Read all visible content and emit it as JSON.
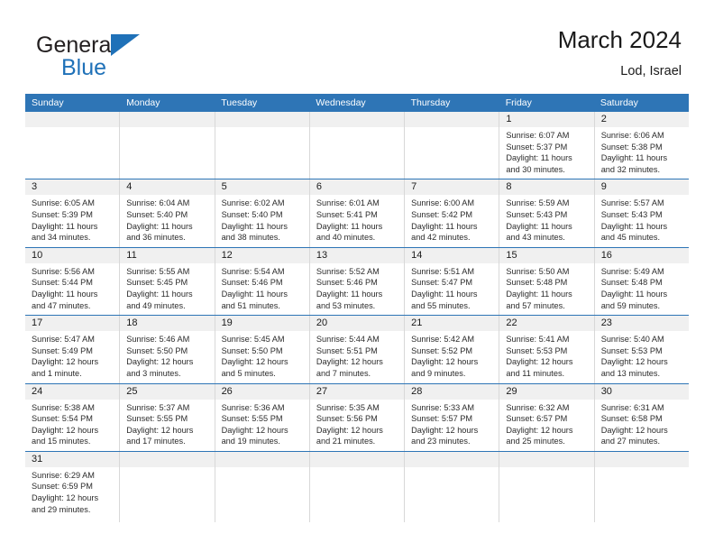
{
  "brand": {
    "name_part1": "General",
    "name_part2": "Blue",
    "logo_icon": "blue-triangle-flag-icon"
  },
  "header": {
    "title": "March 2024",
    "location": "Lod, Israel"
  },
  "colors": {
    "header_blue": "#2e75b6",
    "brand_blue": "#1f71b8",
    "day_band_grey": "#f0f0f0",
    "cell_border": "#d8d8d8"
  },
  "weekdays": [
    "Sunday",
    "Monday",
    "Tuesday",
    "Wednesday",
    "Thursday",
    "Friday",
    "Saturday"
  ],
  "weeks": [
    [
      {
        "day": "",
        "lines": []
      },
      {
        "day": "",
        "lines": []
      },
      {
        "day": "",
        "lines": []
      },
      {
        "day": "",
        "lines": []
      },
      {
        "day": "",
        "lines": []
      },
      {
        "day": "1",
        "lines": [
          "Sunrise: 6:07 AM",
          "Sunset: 5:37 PM",
          "Daylight: 11 hours",
          "and 30 minutes."
        ]
      },
      {
        "day": "2",
        "lines": [
          "Sunrise: 6:06 AM",
          "Sunset: 5:38 PM",
          "Daylight: 11 hours",
          "and 32 minutes."
        ]
      }
    ],
    [
      {
        "day": "3",
        "lines": [
          "Sunrise: 6:05 AM",
          "Sunset: 5:39 PM",
          "Daylight: 11 hours",
          "and 34 minutes."
        ]
      },
      {
        "day": "4",
        "lines": [
          "Sunrise: 6:04 AM",
          "Sunset: 5:40 PM",
          "Daylight: 11 hours",
          "and 36 minutes."
        ]
      },
      {
        "day": "5",
        "lines": [
          "Sunrise: 6:02 AM",
          "Sunset: 5:40 PM",
          "Daylight: 11 hours",
          "and 38 minutes."
        ]
      },
      {
        "day": "6",
        "lines": [
          "Sunrise: 6:01 AM",
          "Sunset: 5:41 PM",
          "Daylight: 11 hours",
          "and 40 minutes."
        ]
      },
      {
        "day": "7",
        "lines": [
          "Sunrise: 6:00 AM",
          "Sunset: 5:42 PM",
          "Daylight: 11 hours",
          "and 42 minutes."
        ]
      },
      {
        "day": "8",
        "lines": [
          "Sunrise: 5:59 AM",
          "Sunset: 5:43 PM",
          "Daylight: 11 hours",
          "and 43 minutes."
        ]
      },
      {
        "day": "9",
        "lines": [
          "Sunrise: 5:57 AM",
          "Sunset: 5:43 PM",
          "Daylight: 11 hours",
          "and 45 minutes."
        ]
      }
    ],
    [
      {
        "day": "10",
        "lines": [
          "Sunrise: 5:56 AM",
          "Sunset: 5:44 PM",
          "Daylight: 11 hours",
          "and 47 minutes."
        ]
      },
      {
        "day": "11",
        "lines": [
          "Sunrise: 5:55 AM",
          "Sunset: 5:45 PM",
          "Daylight: 11 hours",
          "and 49 minutes."
        ]
      },
      {
        "day": "12",
        "lines": [
          "Sunrise: 5:54 AM",
          "Sunset: 5:46 PM",
          "Daylight: 11 hours",
          "and 51 minutes."
        ]
      },
      {
        "day": "13",
        "lines": [
          "Sunrise: 5:52 AM",
          "Sunset: 5:46 PM",
          "Daylight: 11 hours",
          "and 53 minutes."
        ]
      },
      {
        "day": "14",
        "lines": [
          "Sunrise: 5:51 AM",
          "Sunset: 5:47 PM",
          "Daylight: 11 hours",
          "and 55 minutes."
        ]
      },
      {
        "day": "15",
        "lines": [
          "Sunrise: 5:50 AM",
          "Sunset: 5:48 PM",
          "Daylight: 11 hours",
          "and 57 minutes."
        ]
      },
      {
        "day": "16",
        "lines": [
          "Sunrise: 5:49 AM",
          "Sunset: 5:48 PM",
          "Daylight: 11 hours",
          "and 59 minutes."
        ]
      }
    ],
    [
      {
        "day": "17",
        "lines": [
          "Sunrise: 5:47 AM",
          "Sunset: 5:49 PM",
          "Daylight: 12 hours",
          "and 1 minute."
        ]
      },
      {
        "day": "18",
        "lines": [
          "Sunrise: 5:46 AM",
          "Sunset: 5:50 PM",
          "Daylight: 12 hours",
          "and 3 minutes."
        ]
      },
      {
        "day": "19",
        "lines": [
          "Sunrise: 5:45 AM",
          "Sunset: 5:50 PM",
          "Daylight: 12 hours",
          "and 5 minutes."
        ]
      },
      {
        "day": "20",
        "lines": [
          "Sunrise: 5:44 AM",
          "Sunset: 5:51 PM",
          "Daylight: 12 hours",
          "and 7 minutes."
        ]
      },
      {
        "day": "21",
        "lines": [
          "Sunrise: 5:42 AM",
          "Sunset: 5:52 PM",
          "Daylight: 12 hours",
          "and 9 minutes."
        ]
      },
      {
        "day": "22",
        "lines": [
          "Sunrise: 5:41 AM",
          "Sunset: 5:53 PM",
          "Daylight: 12 hours",
          "and 11 minutes."
        ]
      },
      {
        "day": "23",
        "lines": [
          "Sunrise: 5:40 AM",
          "Sunset: 5:53 PM",
          "Daylight: 12 hours",
          "and 13 minutes."
        ]
      }
    ],
    [
      {
        "day": "24",
        "lines": [
          "Sunrise: 5:38 AM",
          "Sunset: 5:54 PM",
          "Daylight: 12 hours",
          "and 15 minutes."
        ]
      },
      {
        "day": "25",
        "lines": [
          "Sunrise: 5:37 AM",
          "Sunset: 5:55 PM",
          "Daylight: 12 hours",
          "and 17 minutes."
        ]
      },
      {
        "day": "26",
        "lines": [
          "Sunrise: 5:36 AM",
          "Sunset: 5:55 PM",
          "Daylight: 12 hours",
          "and 19 minutes."
        ]
      },
      {
        "day": "27",
        "lines": [
          "Sunrise: 5:35 AM",
          "Sunset: 5:56 PM",
          "Daylight: 12 hours",
          "and 21 minutes."
        ]
      },
      {
        "day": "28",
        "lines": [
          "Sunrise: 5:33 AM",
          "Sunset: 5:57 PM",
          "Daylight: 12 hours",
          "and 23 minutes."
        ]
      },
      {
        "day": "29",
        "lines": [
          "Sunrise: 6:32 AM",
          "Sunset: 6:57 PM",
          "Daylight: 12 hours",
          "and 25 minutes."
        ]
      },
      {
        "day": "30",
        "lines": [
          "Sunrise: 6:31 AM",
          "Sunset: 6:58 PM",
          "Daylight: 12 hours",
          "and 27 minutes."
        ]
      }
    ],
    [
      {
        "day": "31",
        "lines": [
          "Sunrise: 6:29 AM",
          "Sunset: 6:59 PM",
          "Daylight: 12 hours",
          "and 29 minutes."
        ]
      },
      {
        "day": "",
        "lines": []
      },
      {
        "day": "",
        "lines": []
      },
      {
        "day": "",
        "lines": []
      },
      {
        "day": "",
        "lines": []
      },
      {
        "day": "",
        "lines": []
      },
      {
        "day": "",
        "lines": []
      }
    ]
  ]
}
